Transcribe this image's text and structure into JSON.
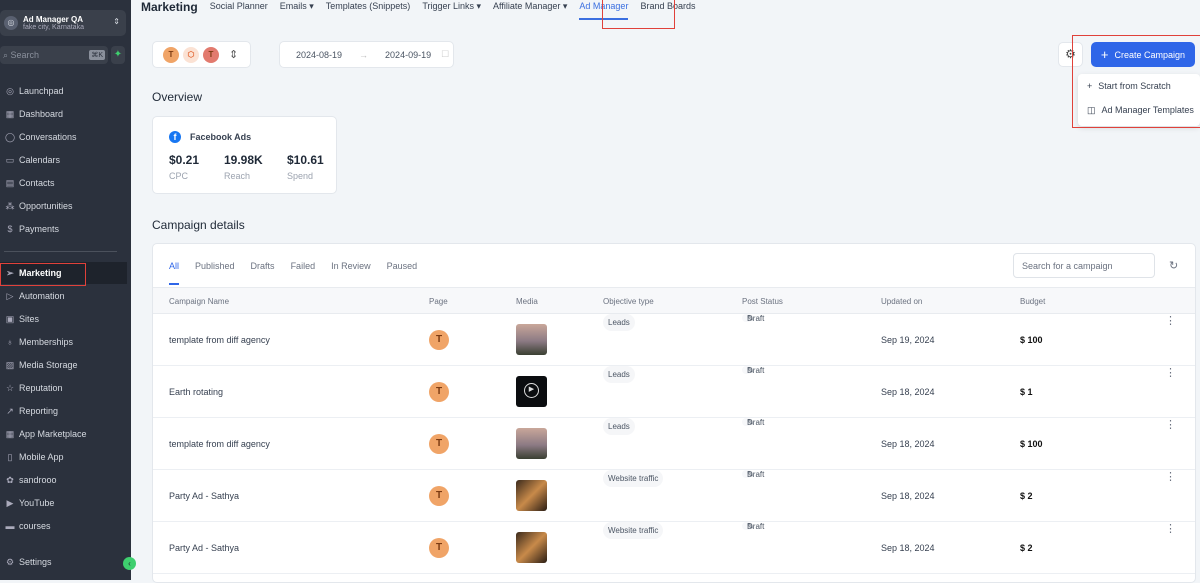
{
  "sidebar": {
    "account": {
      "name": "Ad Manager QA",
      "location": "fake city, Karnataka"
    },
    "search": {
      "placeholder": "Search",
      "shortcut": "⌘K"
    },
    "items": [
      {
        "label": "Launchpad",
        "icon": "rocket-icon"
      },
      {
        "label": "Dashboard",
        "icon": "dashboard-icon"
      },
      {
        "label": "Conversations",
        "icon": "chat-icon"
      },
      {
        "label": "Calendars",
        "icon": "calendar-icon"
      },
      {
        "label": "Contacts",
        "icon": "contacts-icon"
      },
      {
        "label": "Opportunities",
        "icon": "opportunities-icon"
      },
      {
        "label": "Payments",
        "icon": "payments-icon"
      },
      {
        "label": "Marketing",
        "icon": "send-icon",
        "active": true
      },
      {
        "label": "Automation",
        "icon": "automation-icon"
      },
      {
        "label": "Sites",
        "icon": "sites-icon"
      },
      {
        "label": "Memberships",
        "icon": "award-icon"
      },
      {
        "label": "Media Storage",
        "icon": "image-icon"
      },
      {
        "label": "Reputation",
        "icon": "star-icon"
      },
      {
        "label": "Reporting",
        "icon": "trend-icon"
      },
      {
        "label": "App Marketplace",
        "icon": "grid-icon"
      },
      {
        "label": "Mobile App",
        "icon": "phone-icon"
      },
      {
        "label": "sandrooo",
        "icon": "custom-icon"
      },
      {
        "label": "YouTube",
        "icon": "youtube-icon"
      },
      {
        "label": "courses",
        "icon": "courses-icon"
      }
    ],
    "settings": "Settings"
  },
  "topnav": {
    "title": "Marketing",
    "tabs": [
      "Social Planner",
      "Emails ▾",
      "Templates (Snippets)",
      "Trigger Links ▾",
      "Affiliate Manager ▾",
      "Ad Manager",
      "Brand Boards"
    ],
    "active": "Ad Manager"
  },
  "filters": {
    "accounts": [
      "T",
      "",
      "T"
    ],
    "date_from": "2024-08-19",
    "date_to": "2024-09-19"
  },
  "actions": {
    "create": "Create Campaign",
    "menu": [
      "Start from Scratch",
      "Ad Manager Templates"
    ]
  },
  "overview": {
    "title": "Overview",
    "platform": "Facebook Ads",
    "stats": [
      {
        "value": "$0.21",
        "label": "CPC"
      },
      {
        "value": "19.98K",
        "label": "Reach"
      },
      {
        "value": "$10.61",
        "label": "Spend"
      }
    ]
  },
  "campaigns": {
    "title": "Campaign details",
    "tabs": [
      "All",
      "Published",
      "Drafts",
      "Failed",
      "In Review",
      "Paused"
    ],
    "search_placeholder": "Search for a campaign",
    "columns": [
      "Campaign Name",
      "Page",
      "Media",
      "Objective type",
      "Post Status",
      "Updated on",
      "Budget"
    ],
    "rows": [
      {
        "name": "template from diff agency",
        "page": "T",
        "media": "sunset",
        "objective": "Leads",
        "status": "Draft",
        "updated": "Sep 19, 2024",
        "budget": "$ 100"
      },
      {
        "name": "Earth rotating",
        "page": "T",
        "media": "video",
        "objective": "Leads",
        "status": "Draft",
        "updated": "Sep 18, 2024",
        "budget": "$ 1"
      },
      {
        "name": "template from diff agency",
        "page": "T",
        "media": "sunset",
        "objective": "Leads",
        "status": "Draft",
        "updated": "Sep 18, 2024",
        "budget": "$ 100"
      },
      {
        "name": "Party Ad - Sathya",
        "page": "T",
        "media": "party",
        "objective": "Website traffic",
        "status": "Draft",
        "updated": "Sep 18, 2024",
        "budget": "$ 2"
      },
      {
        "name": "Party Ad - Sathya",
        "page": "T",
        "media": "party",
        "objective": "Website traffic",
        "status": "Draft",
        "updated": "Sep 18, 2024",
        "budget": "$ 2"
      }
    ]
  },
  "colors": {
    "accent": "#2f66e8",
    "sidebar": "#2b313d",
    "highlight": "#e0413a",
    "avatar": "#f0a467"
  }
}
